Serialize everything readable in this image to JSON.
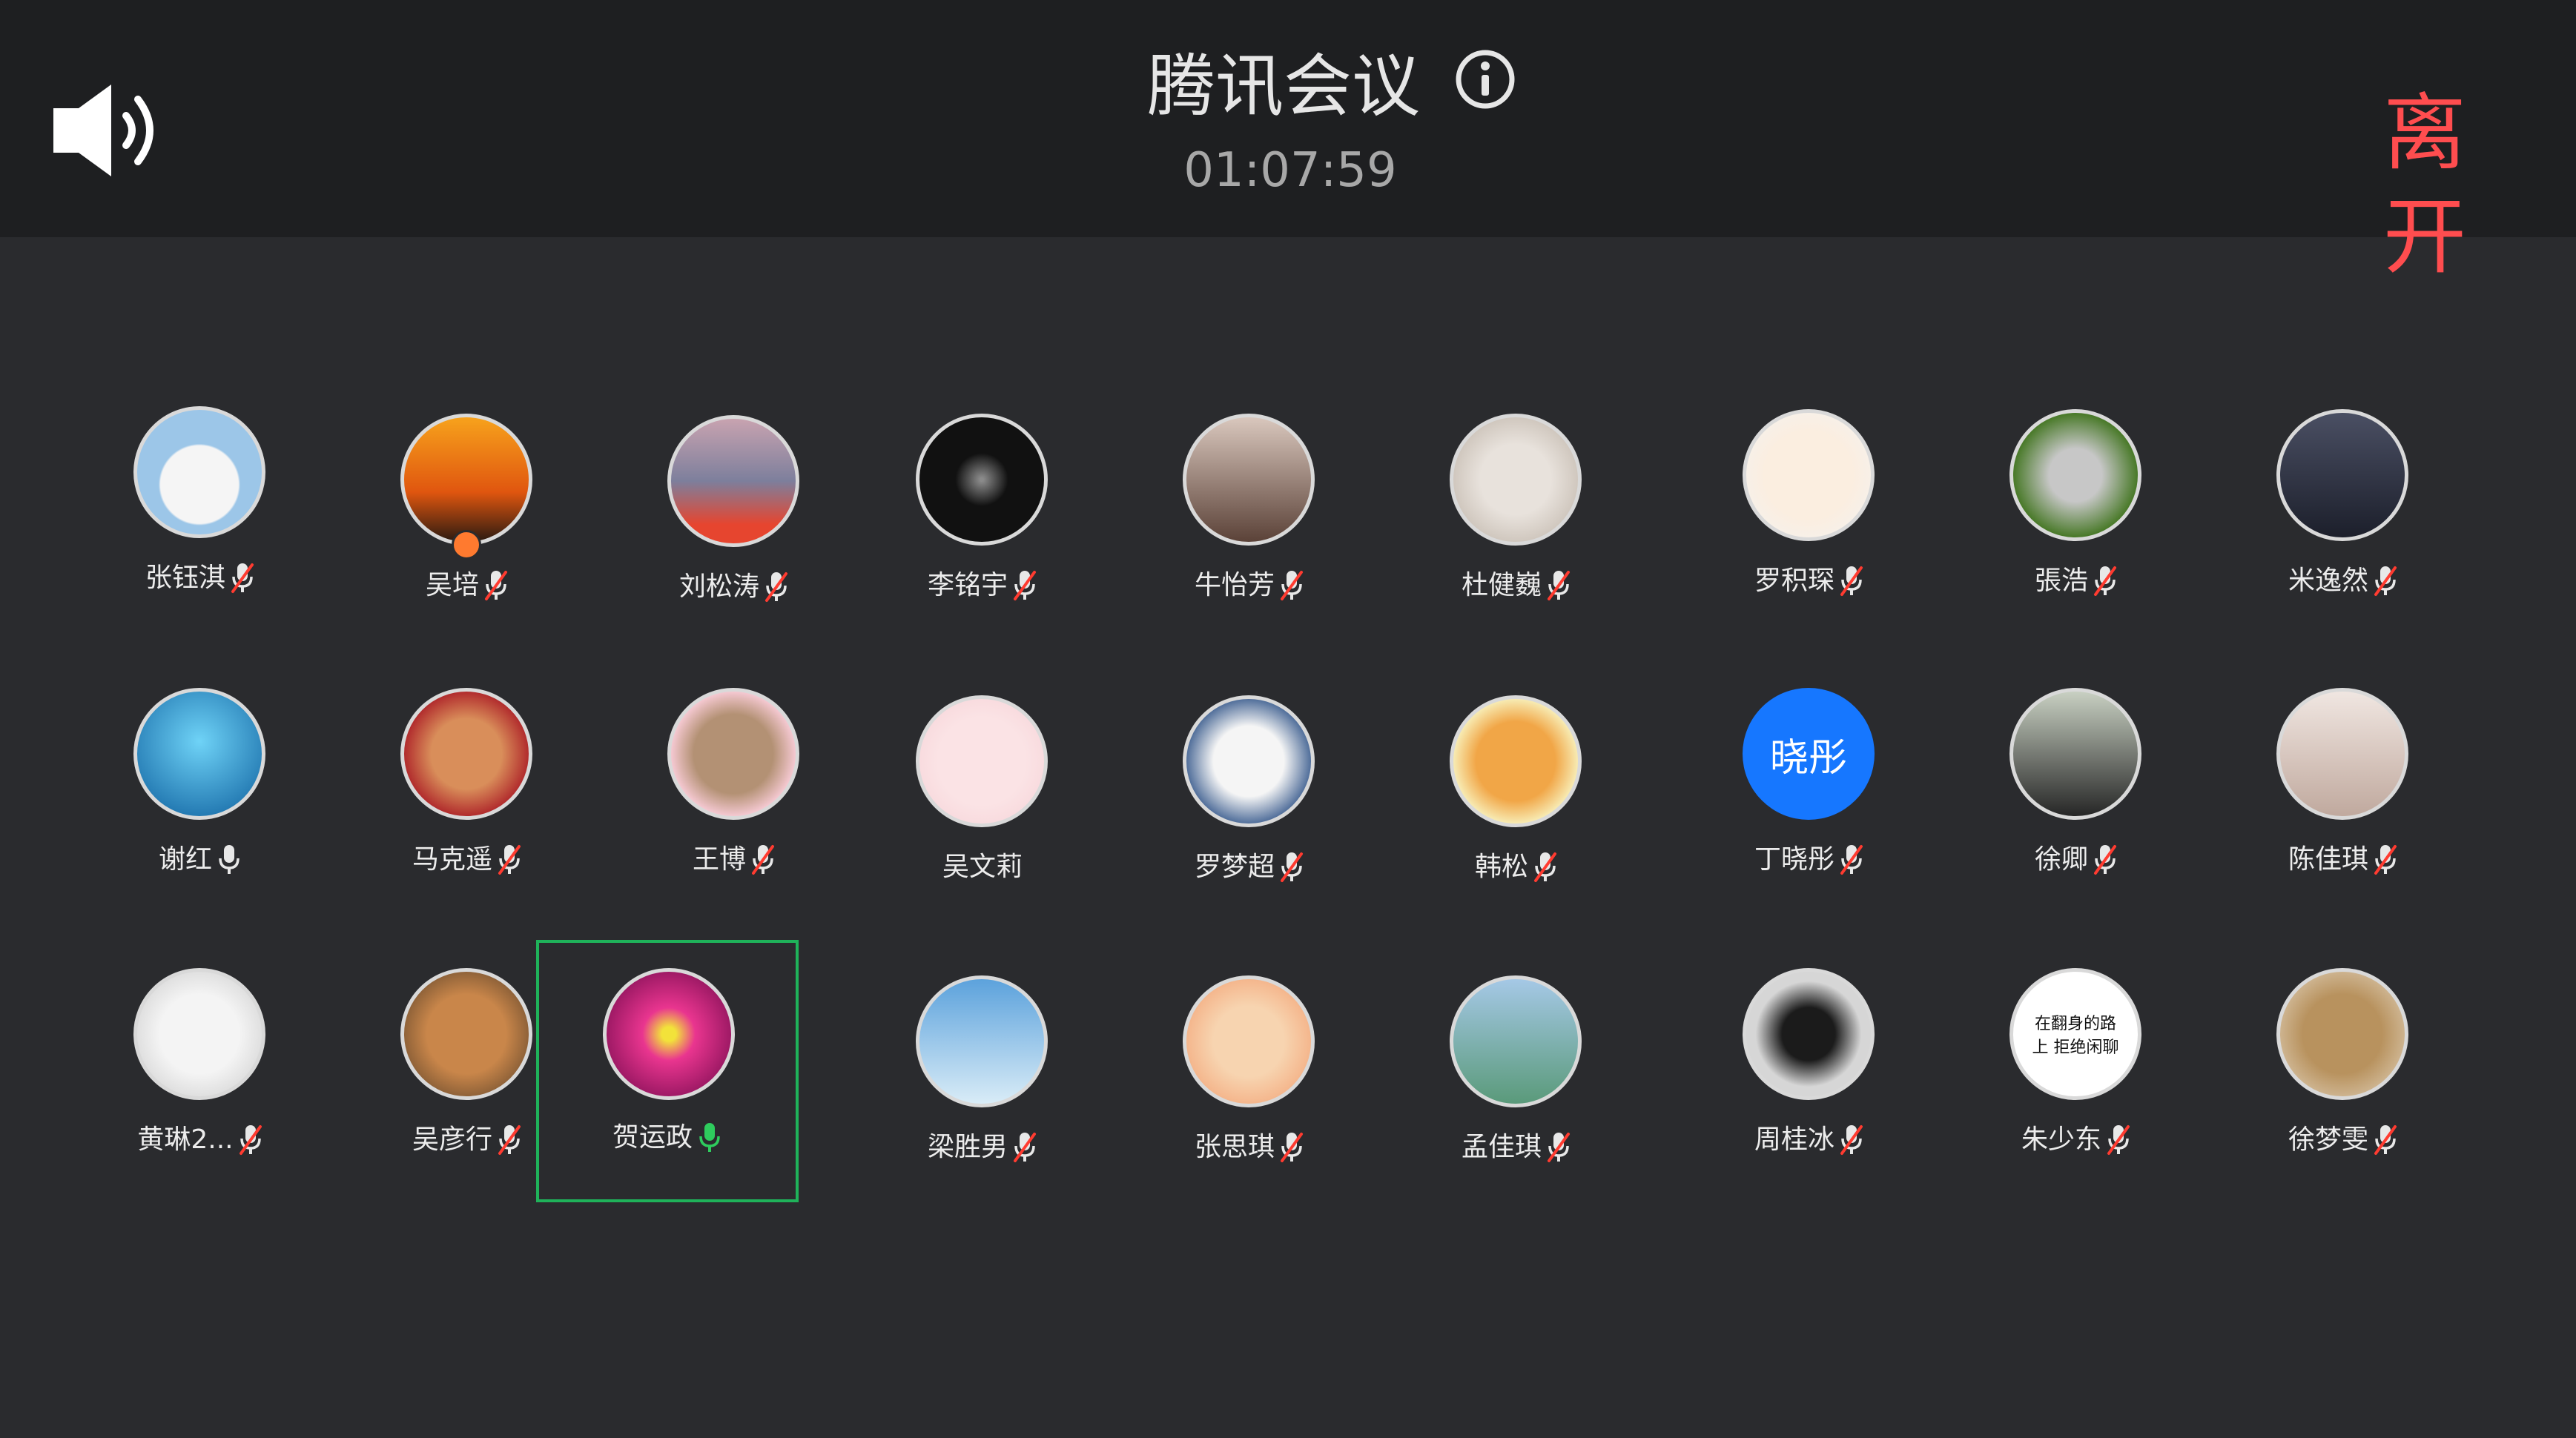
{
  "header": {
    "title": "腾讯会议",
    "timer": "01:07:59",
    "leave_label": "离开"
  },
  "colors": {
    "accent_blue": "#1677ff",
    "leave_red": "#ff4d4f",
    "speaking_green": "#1fb25a",
    "muted_red": "#ff3b30"
  },
  "participants": [
    {
      "name": "张钰淇",
      "mic": "muted",
      "avatar": "bear-hat"
    },
    {
      "name": "吴培",
      "mic": "muted",
      "avatar": "sunset-silhouette",
      "badge": "host-icon"
    },
    {
      "name": "刘松涛",
      "mic": "muted",
      "avatar": "landscape"
    },
    {
      "name": "李铭宇",
      "mic": "muted",
      "avatar": "galaxy"
    },
    {
      "name": "牛怡芳",
      "mic": "muted",
      "avatar": "portrait-girl"
    },
    {
      "name": "杜健巍",
      "mic": "muted",
      "avatar": "cat"
    },
    {
      "name": "罗积琛",
      "mic": "muted",
      "avatar": "cartoon-cat"
    },
    {
      "name": "張浩",
      "mic": "muted",
      "avatar": "bugs-bunny"
    },
    {
      "name": "米逸然",
      "mic": "muted",
      "avatar": "suit-figure"
    },
    {
      "name": "谢红",
      "mic": "on",
      "avatar": "aquarium"
    },
    {
      "name": "马克遥",
      "mic": "muted",
      "avatar": "cat-santa"
    },
    {
      "name": "王博",
      "mic": "muted",
      "avatar": "bear-face"
    },
    {
      "name": "吴文莉",
      "mic": "none",
      "avatar": "anime-girl"
    },
    {
      "name": "罗梦超",
      "mic": "muted",
      "avatar": "sailor-cartoon"
    },
    {
      "name": "韩松",
      "mic": "muted",
      "avatar": "shiba"
    },
    {
      "name": "丁晓彤",
      "mic": "muted",
      "avatar": "text",
      "avatar_text": "晓彤"
    },
    {
      "name": "徐卿",
      "mic": "muted",
      "avatar": "photo-person"
    },
    {
      "name": "陈佳琪",
      "mic": "muted",
      "avatar": "selfie"
    },
    {
      "name": "黄琳2...",
      "mic": "muted",
      "avatar": "sleeping-cat"
    },
    {
      "name": "吴彦行",
      "mic": "muted",
      "avatar": "dog"
    },
    {
      "name": "贺运政",
      "mic": "speaking",
      "avatar": "pink-flower",
      "active": true
    },
    {
      "name": "梁胜男",
      "mic": "muted",
      "avatar": "sky-clouds"
    },
    {
      "name": "张思琪",
      "mic": "muted",
      "avatar": "chibi-girl"
    },
    {
      "name": "孟佳琪",
      "mic": "muted",
      "avatar": "park-scene"
    },
    {
      "name": "周桂冰",
      "mic": "muted",
      "avatar": "penguin-figure"
    },
    {
      "name": "朱少东",
      "mic": "muted",
      "avatar": "fish-meme",
      "avatar_text": "在翻身的路上 拒绝闲聊"
    },
    {
      "name": "徐梦雯",
      "mic": "muted",
      "avatar": "tabby-cat"
    }
  ]
}
